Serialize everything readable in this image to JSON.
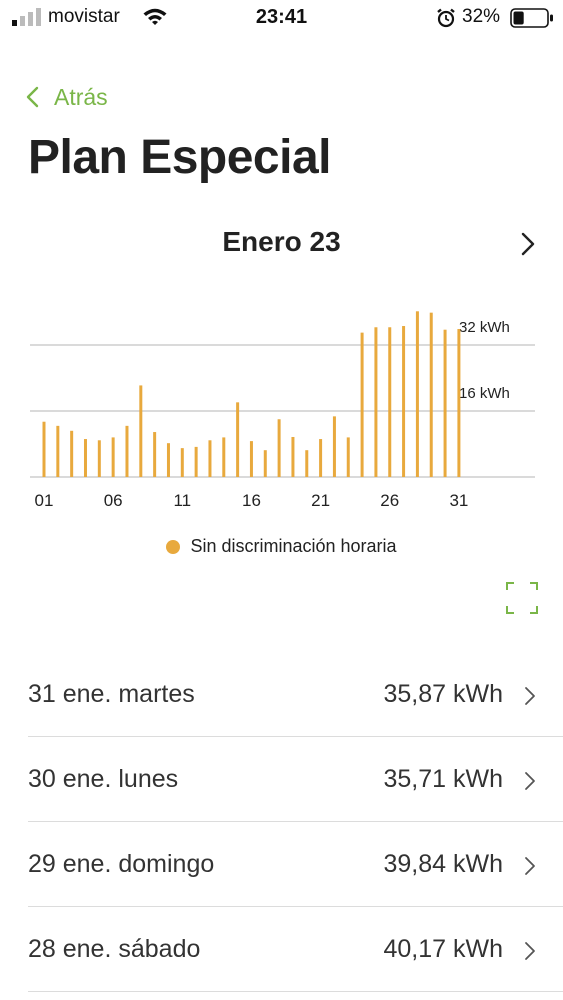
{
  "status_bar": {
    "carrier": "movistar",
    "time": "23:41",
    "battery": "32%",
    "battery_level": 0.32
  },
  "nav": {
    "back_label": "Atrás"
  },
  "page": {
    "title": "Plan Especial"
  },
  "month": {
    "label": "Enero 23"
  },
  "chart_data": {
    "type": "bar",
    "x": [
      1,
      2,
      3,
      4,
      5,
      6,
      7,
      8,
      9,
      10,
      11,
      12,
      13,
      14,
      15,
      16,
      17,
      18,
      19,
      20,
      21,
      22,
      23,
      24,
      25,
      26,
      27,
      28,
      29,
      30,
      31
    ],
    "x_tick_labels": [
      "01",
      "06",
      "11",
      "16",
      "21",
      "26",
      "31"
    ],
    "x_tick_values": [
      1,
      6,
      11,
      16,
      21,
      26,
      31
    ],
    "y_tick_labels": [
      "16 kWh",
      "32 kWh"
    ],
    "y_tick_values": [
      16,
      32
    ],
    "ylim": [
      0,
      40
    ],
    "series": [
      {
        "name": "Sin discriminación horaria",
        "color": "#e8a93d",
        "values": [
          13.4,
          12.4,
          11.2,
          9.2,
          8.9,
          9.6,
          12.4,
          22.2,
          10.9,
          8.2,
          7.0,
          7.3,
          8.9,
          9.6,
          18.1,
          8.7,
          6.5,
          14.0,
          9.7,
          6.5,
          9.2,
          14.7,
          9.6,
          35.0,
          36.3,
          36.3,
          36.6,
          40.17,
          39.84,
          35.71,
          35.87
        ]
      }
    ],
    "grid": true
  },
  "legend": {
    "label": "Sin discriminación horaria",
    "color": "#e8a93d"
  },
  "list": [
    {
      "date": "31 ene. martes",
      "value": "35,87 kWh"
    },
    {
      "date": "30 ene. lunes",
      "value": "35,71 kWh"
    },
    {
      "date": "29 ene. domingo",
      "value": "39,84 kWh"
    },
    {
      "date": "28 ene. sábado",
      "value": "40,17 kWh"
    }
  ],
  "colors": {
    "accent": "#7ab648",
    "bar": "#e8a93d"
  }
}
